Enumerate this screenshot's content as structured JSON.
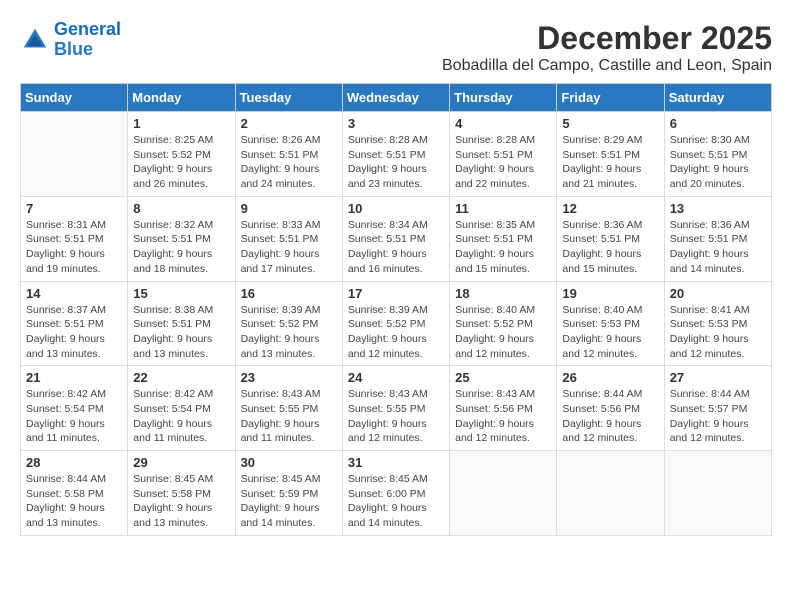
{
  "logo": {
    "line1": "General",
    "line2": "Blue"
  },
  "title": "December 2025",
  "subtitle": "Bobadilla del Campo, Castille and Leon, Spain",
  "weekdays": [
    "Sunday",
    "Monday",
    "Tuesday",
    "Wednesday",
    "Thursday",
    "Friday",
    "Saturday"
  ],
  "weeks": [
    [
      {
        "day": "",
        "info": ""
      },
      {
        "day": "1",
        "info": "Sunrise: 8:25 AM\nSunset: 5:52 PM\nDaylight: 9 hours\nand 26 minutes."
      },
      {
        "day": "2",
        "info": "Sunrise: 8:26 AM\nSunset: 5:51 PM\nDaylight: 9 hours\nand 24 minutes."
      },
      {
        "day": "3",
        "info": "Sunrise: 8:28 AM\nSunset: 5:51 PM\nDaylight: 9 hours\nand 23 minutes."
      },
      {
        "day": "4",
        "info": "Sunrise: 8:28 AM\nSunset: 5:51 PM\nDaylight: 9 hours\nand 22 minutes."
      },
      {
        "day": "5",
        "info": "Sunrise: 8:29 AM\nSunset: 5:51 PM\nDaylight: 9 hours\nand 21 minutes."
      },
      {
        "day": "6",
        "info": "Sunrise: 8:30 AM\nSunset: 5:51 PM\nDaylight: 9 hours\nand 20 minutes."
      }
    ],
    [
      {
        "day": "7",
        "info": "Sunrise: 8:31 AM\nSunset: 5:51 PM\nDaylight: 9 hours\nand 19 minutes."
      },
      {
        "day": "8",
        "info": "Sunrise: 8:32 AM\nSunset: 5:51 PM\nDaylight: 9 hours\nand 18 minutes."
      },
      {
        "day": "9",
        "info": "Sunrise: 8:33 AM\nSunset: 5:51 PM\nDaylight: 9 hours\nand 17 minutes."
      },
      {
        "day": "10",
        "info": "Sunrise: 8:34 AM\nSunset: 5:51 PM\nDaylight: 9 hours\nand 16 minutes."
      },
      {
        "day": "11",
        "info": "Sunrise: 8:35 AM\nSunset: 5:51 PM\nDaylight: 9 hours\nand 15 minutes."
      },
      {
        "day": "12",
        "info": "Sunrise: 8:36 AM\nSunset: 5:51 PM\nDaylight: 9 hours\nand 15 minutes."
      },
      {
        "day": "13",
        "info": "Sunrise: 8:36 AM\nSunset: 5:51 PM\nDaylight: 9 hours\nand 14 minutes."
      }
    ],
    [
      {
        "day": "14",
        "info": "Sunrise: 8:37 AM\nSunset: 5:51 PM\nDaylight: 9 hours\nand 13 minutes."
      },
      {
        "day": "15",
        "info": "Sunrise: 8:38 AM\nSunset: 5:51 PM\nDaylight: 9 hours\nand 13 minutes."
      },
      {
        "day": "16",
        "info": "Sunrise: 8:39 AM\nSunset: 5:52 PM\nDaylight: 9 hours\nand 13 minutes."
      },
      {
        "day": "17",
        "info": "Sunrise: 8:39 AM\nSunset: 5:52 PM\nDaylight: 9 hours\nand 12 minutes."
      },
      {
        "day": "18",
        "info": "Sunrise: 8:40 AM\nSunset: 5:52 PM\nDaylight: 9 hours\nand 12 minutes."
      },
      {
        "day": "19",
        "info": "Sunrise: 8:40 AM\nSunset: 5:53 PM\nDaylight: 9 hours\nand 12 minutes."
      },
      {
        "day": "20",
        "info": "Sunrise: 8:41 AM\nSunset: 5:53 PM\nDaylight: 9 hours\nand 12 minutes."
      }
    ],
    [
      {
        "day": "21",
        "info": "Sunrise: 8:42 AM\nSunset: 5:54 PM\nDaylight: 9 hours\nand 11 minutes."
      },
      {
        "day": "22",
        "info": "Sunrise: 8:42 AM\nSunset: 5:54 PM\nDaylight: 9 hours\nand 11 minutes."
      },
      {
        "day": "23",
        "info": "Sunrise: 8:43 AM\nSunset: 5:55 PM\nDaylight: 9 hours\nand 11 minutes."
      },
      {
        "day": "24",
        "info": "Sunrise: 8:43 AM\nSunset: 5:55 PM\nDaylight: 9 hours\nand 12 minutes."
      },
      {
        "day": "25",
        "info": "Sunrise: 8:43 AM\nSunset: 5:56 PM\nDaylight: 9 hours\nand 12 minutes."
      },
      {
        "day": "26",
        "info": "Sunrise: 8:44 AM\nSunset: 5:56 PM\nDaylight: 9 hours\nand 12 minutes."
      },
      {
        "day": "27",
        "info": "Sunrise: 8:44 AM\nSunset: 5:57 PM\nDaylight: 9 hours\nand 12 minutes."
      }
    ],
    [
      {
        "day": "28",
        "info": "Sunrise: 8:44 AM\nSunset: 5:58 PM\nDaylight: 9 hours\nand 13 minutes."
      },
      {
        "day": "29",
        "info": "Sunrise: 8:45 AM\nSunset: 5:58 PM\nDaylight: 9 hours\nand 13 minutes."
      },
      {
        "day": "30",
        "info": "Sunrise: 8:45 AM\nSunset: 5:59 PM\nDaylight: 9 hours\nand 14 minutes."
      },
      {
        "day": "31",
        "info": "Sunrise: 8:45 AM\nSunset: 6:00 PM\nDaylight: 9 hours\nand 14 minutes."
      },
      {
        "day": "",
        "info": ""
      },
      {
        "day": "",
        "info": ""
      },
      {
        "day": "",
        "info": ""
      }
    ]
  ]
}
